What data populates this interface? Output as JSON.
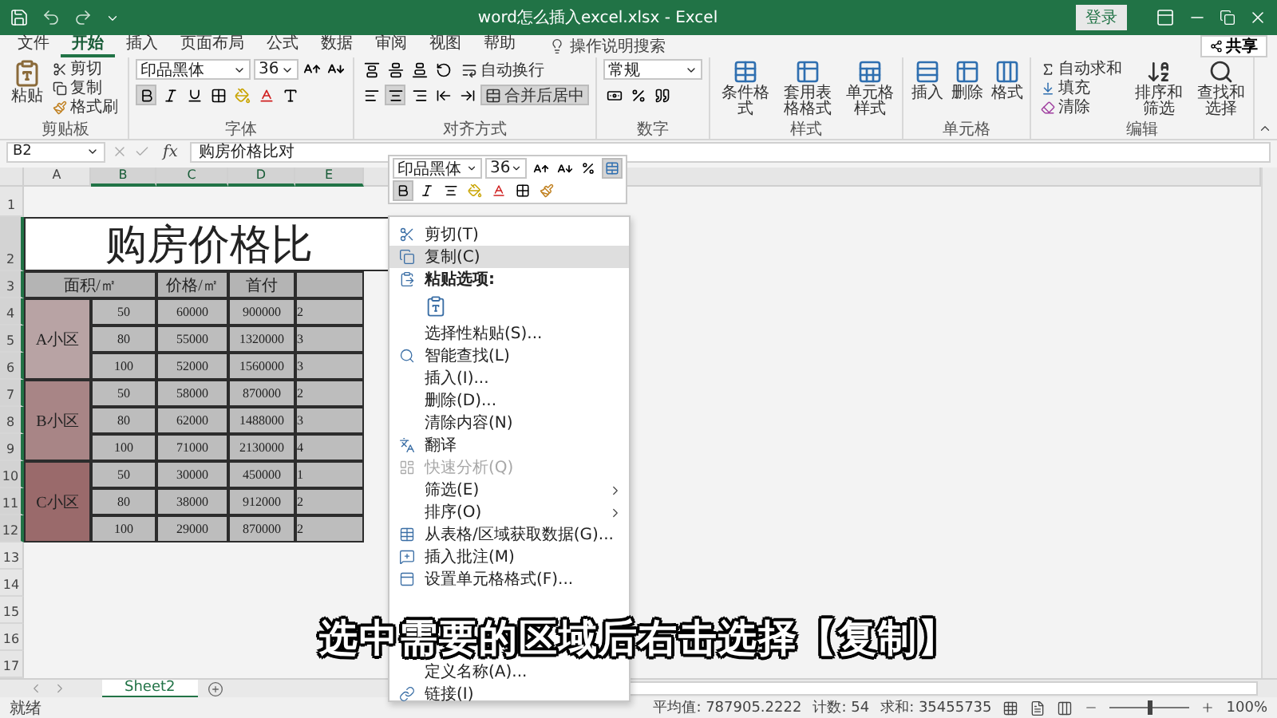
{
  "title_bar": {
    "title": "word怎么插入excel.xlsx - Excel",
    "login": "登录"
  },
  "menu_tabs": [
    {
      "label": "文件",
      "selected": false
    },
    {
      "label": "开始",
      "selected": true
    },
    {
      "label": "插入",
      "selected": false
    },
    {
      "label": "页面布局",
      "selected": false
    },
    {
      "label": "公式",
      "selected": false
    },
    {
      "label": "数据",
      "selected": false
    },
    {
      "label": "审阅",
      "selected": false
    },
    {
      "label": "视图",
      "selected": false
    },
    {
      "label": "帮助",
      "selected": false
    }
  ],
  "tell_me": {
    "placeholder": "操作说明搜索"
  },
  "share": "共享",
  "ribbon": {
    "clipboard": {
      "title": "剪贴板",
      "paste": "粘贴",
      "cut": "剪切",
      "copy": "复制",
      "format_painter": "格式刷"
    },
    "font": {
      "title": "字体",
      "font_name": "印品黑体",
      "font_size": "36",
      "bold": true
    },
    "alignment": {
      "title": "对齐方式",
      "wrap_text": "自动换行",
      "merge_center": "合并后居中",
      "center": true,
      "merged": true
    },
    "number": {
      "title": "数字",
      "format": "常规"
    },
    "styles": {
      "title": "样式",
      "buttons": [
        "条件格式",
        "套用表格格式",
        "单元格样式"
      ]
    },
    "cells": {
      "title": "单元格",
      "buttons": [
        "插入",
        "删除",
        "格式"
      ]
    },
    "editing": {
      "title": "编辑",
      "autosum": "自动求和",
      "fill": "填充",
      "clear": "清除",
      "sort_filter": "排序和筛选",
      "find_select": "查找和选择"
    }
  },
  "formula_bar": {
    "name_box": "B2",
    "fx": "fx",
    "content": "购房价格比对"
  },
  "mini_toolbar": {
    "font_name": "印品黑体",
    "font_size": "36",
    "bold": true
  },
  "sheet": {
    "columns": [
      {
        "label": "A",
        "selected": false
      },
      {
        "label": "B",
        "selected": true
      },
      {
        "label": "C",
        "selected": true
      },
      {
        "label": "D",
        "selected": true
      },
      {
        "label": "E",
        "selected": true
      }
    ],
    "rows": [
      {
        "label": "1",
        "selected": false
      },
      {
        "label": "2",
        "selected": true
      },
      {
        "label": "3",
        "selected": true
      },
      {
        "label": "4",
        "selected": true
      },
      {
        "label": "5",
        "selected": true
      },
      {
        "label": "6",
        "selected": true
      },
      {
        "label": "7",
        "selected": true
      },
      {
        "label": "8",
        "selected": true
      },
      {
        "label": "9",
        "selected": true
      },
      {
        "label": "10",
        "selected": true
      },
      {
        "label": "11",
        "selected": true
      },
      {
        "label": "12",
        "selected": true
      },
      {
        "label": "13",
        "selected": false
      },
      {
        "label": "14",
        "selected": false
      },
      {
        "label": "15",
        "selected": false
      },
      {
        "label": "16",
        "selected": false
      },
      {
        "label": "17",
        "selected": false
      }
    ],
    "title": "购房价格比",
    "headers": [
      "面积/㎡",
      "价格/㎡",
      "首付"
    ],
    "groups": [
      {
        "name": "A小区",
        "color": "#b8a3a4",
        "rows": [
          [
            "50",
            "60000",
            "900000",
            "2"
          ],
          [
            "80",
            "55000",
            "1320000",
            "3"
          ],
          [
            "100",
            "52000",
            "1560000",
            "3"
          ]
        ]
      },
      {
        "name": "B小区",
        "color": "#a88586",
        "rows": [
          [
            "50",
            "58000",
            "870000",
            "2"
          ],
          [
            "80",
            "62000",
            "1488000",
            "3"
          ],
          [
            "100",
            "71000",
            "2130000",
            "4"
          ]
        ]
      },
      {
        "name": "C小区",
        "color": "#9a6a6b",
        "rows": [
          [
            "50",
            "30000",
            "450000",
            "1"
          ],
          [
            "80",
            "38000",
            "912000",
            "2"
          ],
          [
            "100",
            "29000",
            "870000",
            "2"
          ]
        ]
      }
    ]
  },
  "context_menu": {
    "items": [
      {
        "kind": "item",
        "label": "剪切(T)",
        "selected": false,
        "disabled": false,
        "submenu": false
      },
      {
        "kind": "item",
        "label": "复制(C)",
        "selected": true,
        "disabled": false,
        "submenu": false
      },
      {
        "kind": "heading",
        "label": "粘贴选项:",
        "selected": false,
        "disabled": false,
        "submenu": false
      },
      {
        "kind": "paste_icons",
        "selected": false,
        "disabled": false,
        "submenu": false
      },
      {
        "kind": "item",
        "label": "选择性粘贴(S)...",
        "selected": false,
        "disabled": false,
        "submenu": false
      },
      {
        "kind": "item",
        "label": "智能查找(L)",
        "selected": false,
        "disabled": false,
        "submenu": false
      },
      {
        "kind": "item",
        "label": "插入(I)...",
        "selected": false,
        "disabled": false,
        "submenu": false
      },
      {
        "kind": "item",
        "label": "删除(D)...",
        "selected": false,
        "disabled": false,
        "submenu": false
      },
      {
        "kind": "item",
        "label": "清除内容(N)",
        "selected": false,
        "disabled": false,
        "submenu": false
      },
      {
        "kind": "item",
        "label": "翻译",
        "selected": false,
        "disabled": false,
        "submenu": false
      },
      {
        "kind": "item",
        "label": "快速分析(Q)",
        "selected": false,
        "disabled": true,
        "submenu": false
      },
      {
        "kind": "item",
        "label": "筛选(E)",
        "selected": false,
        "disabled": false,
        "submenu": true
      },
      {
        "kind": "item",
        "label": "排序(O)",
        "selected": false,
        "disabled": false,
        "submenu": true
      },
      {
        "kind": "item",
        "label": "从表格/区域获取数据(G)...",
        "selected": false,
        "disabled": false,
        "submenu": false
      },
      {
        "kind": "item",
        "label": "插入批注(M)",
        "selected": false,
        "disabled": false,
        "submenu": false
      },
      {
        "kind": "item",
        "label": "设置单元格格式(F)...",
        "selected": false,
        "disabled": false,
        "submenu": false
      },
      {
        "kind": "item",
        "label": "定义名称(A)...",
        "selected": false,
        "disabled": false,
        "submenu": false
      },
      {
        "kind": "item",
        "label": "链接(I)",
        "selected": false,
        "disabled": false,
        "submenu": false
      }
    ]
  },
  "caption": "选中需要的区域后右击选择【复制】",
  "sheet_tabs": [
    {
      "label": "Sheet2",
      "selected": true
    }
  ],
  "status_bar": {
    "ready": "就绪",
    "average": "平均值: 787905.2222",
    "count": "计数: 54",
    "sum": "求和: 35455735",
    "zoom": "100%",
    "zoom_level": {
      "level": 0.5
    }
  }
}
